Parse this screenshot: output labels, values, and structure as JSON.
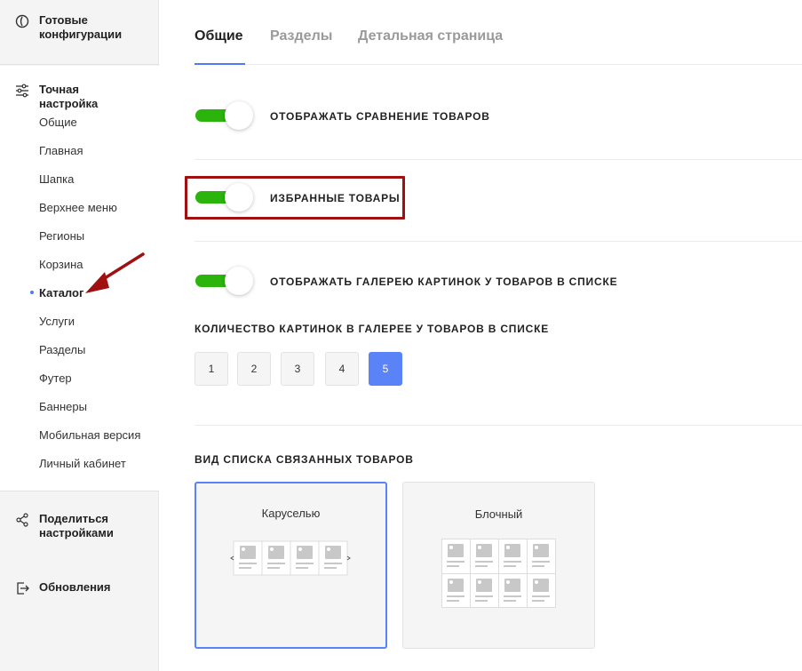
{
  "sidebar": {
    "configs_label": "Готовые конфигурации",
    "tuning_label": "Точная настройка",
    "items": [
      {
        "label": "Общие"
      },
      {
        "label": "Главная"
      },
      {
        "label": "Шапка"
      },
      {
        "label": "Верхнее меню"
      },
      {
        "label": "Регионы"
      },
      {
        "label": "Корзина"
      },
      {
        "label": "Каталог",
        "active": true
      },
      {
        "label": "Услуги"
      },
      {
        "label": "Разделы"
      },
      {
        "label": "Футер"
      },
      {
        "label": "Баннеры"
      },
      {
        "label": "Мобильная версия"
      },
      {
        "label": "Личный кабинет"
      }
    ],
    "share_label": "Поделиться настройками",
    "updates_label": "Обновления"
  },
  "tabs": [
    {
      "label": "Общие",
      "active": true
    },
    {
      "label": "Разделы"
    },
    {
      "label": "Детальная страница"
    }
  ],
  "options": {
    "compare": {
      "label": "ОТОБРАЖАТЬ СРАВНЕНИЕ ТОВАРОВ",
      "on": true
    },
    "favorites": {
      "label": "ИЗБРАННЫЕ ТОВАРЫ",
      "on": true
    },
    "gallery": {
      "label": "ОТОБРАЖАТЬ ГАЛЕРЕЮ КАРТИНОК У ТОВАРОВ В СПИСКЕ",
      "on": true
    }
  },
  "gallery_count": {
    "title": "КОЛИЧЕСТВО КАРТИНОК В ГАЛЕРЕЕ У ТОВАРОВ В СПИСКЕ",
    "options": [
      "1",
      "2",
      "3",
      "4",
      "5"
    ],
    "selected": "5"
  },
  "related_view": {
    "title": "ВИД СПИСКА СВЯЗАННЫХ ТОВАРОВ",
    "carousel_label": "Каруселью",
    "block_label": "Блочный",
    "selected": "carousel"
  },
  "colors": {
    "accent": "#5b83f8",
    "toggle_on": "#2ab40c",
    "highlight": "#a01010"
  }
}
